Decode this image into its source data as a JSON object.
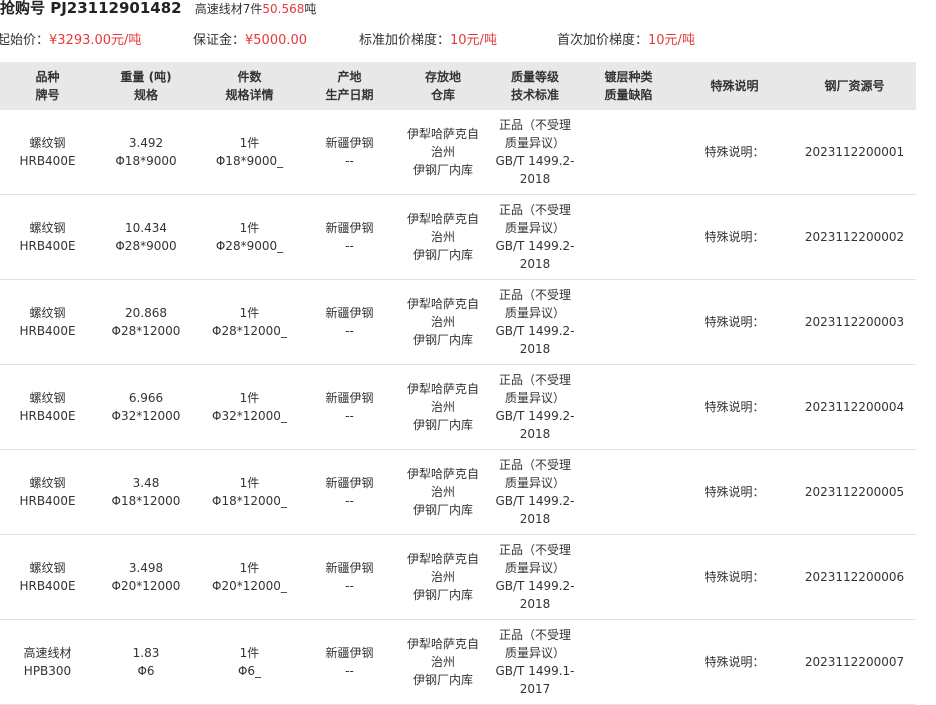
{
  "header": {
    "title_prefix": "抢购号 PJ23112901482",
    "summary_name": "高速线材",
    "summary_count": "7件",
    "summary_weight": "50.568",
    "summary_unit": "吨"
  },
  "params": [
    {
      "label": "起始价：",
      "value": "¥3293.00元/吨",
      "red": true
    },
    {
      "label": "保证金：",
      "value": "¥5000.00",
      "red": true
    },
    {
      "label": "标准加价梯度：",
      "value": "10元/吨",
      "red": true
    },
    {
      "label": "首次加价梯度：",
      "value": "10元/吨",
      "red": true
    }
  ],
  "table": {
    "headers": [
      [
        "品种",
        "牌号"
      ],
      [
        "重量 (吨)",
        "规格"
      ],
      [
        "件数",
        "规格详情"
      ],
      [
        "产地",
        "生产日期"
      ],
      [
        "存放地",
        "仓库"
      ],
      [
        "质量等级",
        "技术标准"
      ],
      [
        "镀层种类",
        "质量缺陷"
      ],
      [
        "特殊说明",
        ""
      ],
      [
        "钢厂资源号",
        ""
      ]
    ],
    "rows": [
      {
        "variety": "螺纹钢",
        "grade": "HRB400E",
        "weight": "3.492",
        "spec": "Φ18*9000",
        "count": "1件",
        "spec_detail": "Φ18*9000_",
        "origin": "新疆伊钢",
        "prod_date": "--",
        "storage_1": "伊犁哈萨克自",
        "storage_2": "治州",
        "warehouse": "伊钢厂内库",
        "quality_1": "正品（不受理",
        "quality_2": "质量异议）",
        "standard_1": "GB/T 1499.2-",
        "standard_2": "2018",
        "coating": "",
        "defect": "",
        "special": "特殊说明：",
        "resource": "2023112200001"
      },
      {
        "variety": "螺纹钢",
        "grade": "HRB400E",
        "weight": "10.434",
        "spec": "Φ28*9000",
        "count": "1件",
        "spec_detail": "Φ28*9000_",
        "origin": "新疆伊钢",
        "prod_date": "--",
        "storage_1": "伊犁哈萨克自",
        "storage_2": "治州",
        "warehouse": "伊钢厂内库",
        "quality_1": "正品（不受理",
        "quality_2": "质量异议）",
        "standard_1": "GB/T 1499.2-",
        "standard_2": "2018",
        "coating": "",
        "defect": "",
        "special": "特殊说明：",
        "resource": "2023112200002"
      },
      {
        "variety": "螺纹钢",
        "grade": "HRB400E",
        "weight": "20.868",
        "spec": "Φ28*12000",
        "count": "1件",
        "spec_detail": "Φ28*12000_",
        "origin": "新疆伊钢",
        "prod_date": "--",
        "storage_1": "伊犁哈萨克自",
        "storage_2": "治州",
        "warehouse": "伊钢厂内库",
        "quality_1": "正品（不受理",
        "quality_2": "质量异议）",
        "standard_1": "GB/T 1499.2-",
        "standard_2": "2018",
        "coating": "",
        "defect": "",
        "special": "特殊说明：",
        "resource": "2023112200003"
      },
      {
        "variety": "螺纹钢",
        "grade": "HRB400E",
        "weight": "6.966",
        "spec": "Φ32*12000",
        "count": "1件",
        "spec_detail": "Φ32*12000_",
        "origin": "新疆伊钢",
        "prod_date": "--",
        "storage_1": "伊犁哈萨克自",
        "storage_2": "治州",
        "warehouse": "伊钢厂内库",
        "quality_1": "正品（不受理",
        "quality_2": "质量异议）",
        "standard_1": "GB/T 1499.2-",
        "standard_2": "2018",
        "coating": "",
        "defect": "",
        "special": "特殊说明：",
        "resource": "2023112200004"
      },
      {
        "variety": "螺纹钢",
        "grade": "HRB400E",
        "weight": "3.48",
        "spec": "Φ18*12000",
        "count": "1件",
        "spec_detail": "Φ18*12000_",
        "origin": "新疆伊钢",
        "prod_date": "--",
        "storage_1": "伊犁哈萨克自",
        "storage_2": "治州",
        "warehouse": "伊钢厂内库",
        "quality_1": "正品（不受理",
        "quality_2": "质量异议）",
        "standard_1": "GB/T 1499.2-",
        "standard_2": "2018",
        "coating": "",
        "defect": "",
        "special": "特殊说明：",
        "resource": "2023112200005"
      },
      {
        "variety": "螺纹钢",
        "grade": "HRB400E",
        "weight": "3.498",
        "spec": "Φ20*12000",
        "count": "1件",
        "spec_detail": "Φ20*12000_",
        "origin": "新疆伊钢",
        "prod_date": "--",
        "storage_1": "伊犁哈萨克自",
        "storage_2": "治州",
        "warehouse": "伊钢厂内库",
        "quality_1": "正品（不受理",
        "quality_2": "质量异议）",
        "standard_1": "GB/T 1499.2-",
        "standard_2": "2018",
        "coating": "",
        "defect": "",
        "special": "特殊说明：",
        "resource": "2023112200006"
      },
      {
        "variety": "高速线材",
        "grade": "HPB300",
        "weight": "1.83",
        "spec": "Φ6",
        "count": "1件",
        "spec_detail": "Φ6_",
        "origin": "新疆伊钢",
        "prod_date": "--",
        "storage_1": "伊犁哈萨克自",
        "storage_2": "治州",
        "warehouse": "伊钢厂内库",
        "quality_1": "正品（不受理",
        "quality_2": "质量异议）",
        "standard_1": "GB/T 1499.1-",
        "standard_2": "2017",
        "coating": "",
        "defect": "",
        "special": "特殊说明：",
        "resource": "2023112200007"
      }
    ]
  },
  "colors": {
    "accent_red": "#e4393c",
    "header_bg": "#e8e8e8"
  }
}
